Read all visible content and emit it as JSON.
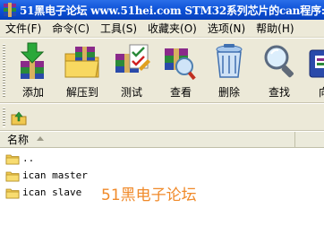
{
  "window": {
    "title": "51黑电子论坛 www.51hei.com STM32系列芯片的can程序:"
  },
  "menu": [
    {
      "label": "文件(F)"
    },
    {
      "label": "命令(C)"
    },
    {
      "label": "工具(S)"
    },
    {
      "label": "收藏夹(O)"
    },
    {
      "label": "选项(N)"
    },
    {
      "label": "帮助(H)"
    }
  ],
  "toolbar": [
    {
      "label": "添加",
      "icon": "add-icon"
    },
    {
      "label": "解压到",
      "icon": "extract-icon"
    },
    {
      "label": "测试",
      "icon": "test-icon"
    },
    {
      "label": "查看",
      "icon": "view-icon"
    },
    {
      "label": "删除",
      "icon": "delete-icon"
    },
    {
      "label": "查找",
      "icon": "find-icon"
    },
    {
      "label": "向",
      "icon": "wizard-icon"
    }
  ],
  "columns": {
    "name": "名称"
  },
  "files": [
    {
      "name": ".."
    },
    {
      "name": "ican master"
    },
    {
      "name": "ican slave"
    }
  ],
  "watermark": "51黑电子论坛",
  "colors": {
    "titlebar": "#0a4fd6",
    "chrome": "#ece9d8",
    "watermark": "#f08a2a"
  }
}
